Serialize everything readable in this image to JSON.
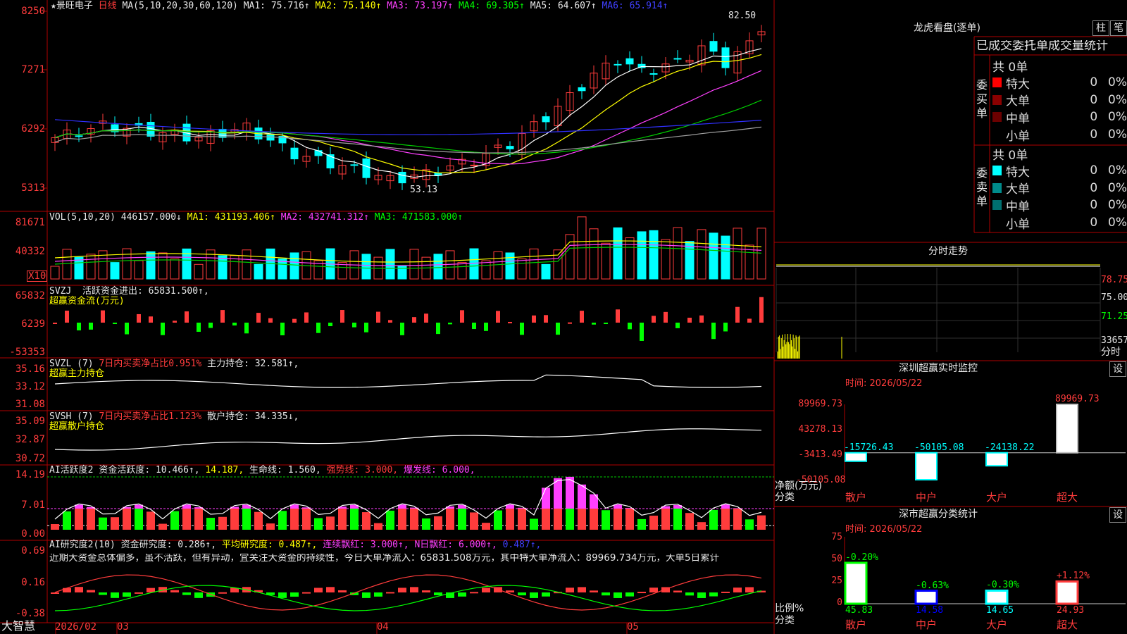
{
  "colors": {
    "up": "#ff3c3c",
    "down": "#00ffff",
    "ma1": "#ffffff",
    "ma2": "#ffff00",
    "ma3": "#ff40ff",
    "ma4": "#00cc00",
    "ma5": "#a0a0a0",
    "ma6": "#3030ff",
    "grid": "#b00000"
  },
  "price_panel": {
    "stock": "★景旺电子",
    "period": "日线",
    "ma_header": "MA(5,10,20,30,60,120)",
    "ma1": "MA1: 75.716↑",
    "ma2": "MA2: 75.140↑",
    "ma3": "MA3: 73.197↑",
    "ma4": "MA4: 69.305↑",
    "ma5": "MA5: 64.607↑",
    "ma6": "MA6: 65.914↑",
    "axis": [
      "8250",
      "7271",
      "6292",
      "5313"
    ],
    "high_label": "82.50",
    "low_label": "53.13"
  },
  "vol_panel": {
    "header": "VOL(5,10,20)",
    "v": "446157.000↓",
    "ma1": "MA1: 431193.406↑",
    "ma2": "MA2: 432741.312↑",
    "ma3": "MA3: 471583.000↑",
    "axis": [
      "81671",
      "40332"
    ],
    "unit": "X10"
  },
  "svzj_panel": {
    "name": "SVZJ",
    "desc": "活跃资金进出: 65831.500↑,",
    "sub": "超赢资金流(万元)",
    "axis": [
      "65832",
      "6239",
      "-53353"
    ]
  },
  "svzl_panel": {
    "name": "SVZL (7)",
    "desc": "7日内买卖净占比0.951%",
    "hold": "主力持仓: 32.581↑,",
    "sub": "超赢主力持仓",
    "axis": [
      "35.16",
      "33.12",
      "31.08"
    ]
  },
  "svsh_panel": {
    "name": "SVSH (7)",
    "desc": "7日内买卖净占比1.123%",
    "hold": "散户持仓: 34.335↓,",
    "sub": "超赢散户持仓",
    "axis": [
      "35.09",
      "32.87",
      "30.72"
    ]
  },
  "ai1_panel": {
    "name": "AI活跃度2",
    "a": "资金活跃度: 10.466↑,",
    "b": "14.187,",
    "c": "生命线: 1.560,",
    "d": "强势线: 3.000,",
    "e": "爆发线: 6.000,",
    "axis": [
      "14.19",
      "7.01",
      "0.00"
    ]
  },
  "ai2_panel": {
    "name": "AI研究度2(10)",
    "a": "资金研究度: 0.286↑,",
    "b": "平均研究度: 0.487↑,",
    "c": "连续飘红: 3.000↑,",
    "d": "N日飘红: 6.000↑,",
    "e": "0.487↑,",
    "comment": "近期大资金总体偏多，虽不活跃，但有异动，宜关注大资金的持续性，今日大单净流入：65831.508万元，其中特大单净流入：89969.734万元，大单5日累计",
    "axis": [
      "0.69",
      "0.16",
      "-0.38"
    ]
  },
  "bottom": {
    "brand": "大智慧",
    "dates": [
      "2026/02",
      "03",
      "04",
      "05"
    ]
  },
  "lhb": {
    "title": "龙虎看盘(逐单)",
    "btn1": "柱",
    "btn2": "笔",
    "tabs": "已成交委托单成交量统计",
    "buy_label": "委买单",
    "sell_label": "委卖单",
    "buy_total": "共 0单",
    "sell_total": "共 0单",
    "buy_rows": [
      {
        "name": "特大",
        "n": "0",
        "p": "0%",
        "color": "#ff0000"
      },
      {
        "name": "大单",
        "n": "0",
        "p": "0%",
        "color": "#8b0000"
      },
      {
        "name": "中单",
        "n": "0",
        "p": "0%",
        "color": "#6b0000"
      },
      {
        "name": "小单",
        "n": "0",
        "p": "0%",
        "color": "#000000"
      }
    ],
    "sell_rows": [
      {
        "name": "特大",
        "n": "0",
        "p": "0%",
        "color": "#00ffff"
      },
      {
        "name": "大单",
        "n": "0",
        "p": "0%",
        "color": "#008b8b"
      },
      {
        "name": "中单",
        "n": "0",
        "p": "0%",
        "color": "#007070"
      },
      {
        "name": "小单",
        "n": "0",
        "p": "0%",
        "color": "#000000"
      }
    ]
  },
  "fenshi": {
    "title": "分时走势",
    "axis": [
      "78.75",
      "75.00",
      "71.25",
      "33657"
    ],
    "unit": "分时"
  },
  "monitor": {
    "title": "深圳超赢实时监控",
    "set": "设",
    "time": "时间: 2026/05/22",
    "axis": [
      "89969.73",
      "43278.13",
      "-3413.49",
      "-50105.08"
    ],
    "ylabel": "净额(万元)",
    "xlab": "分类",
    "chart_data": {
      "type": "bar",
      "categories": [
        "散户",
        "中户",
        "大户",
        "超大"
      ],
      "values": [
        -15726.43,
        -50105.08,
        -24138.22,
        89969.73
      ],
      "labels": [
        "-15726.43",
        "-50105.08",
        "-24138.22",
        "89969.73"
      ],
      "ylim": [
        -50105.08,
        89969.73
      ]
    }
  },
  "stats": {
    "title": "深市超赢分类统计",
    "set": "设",
    "time": "时间: 2026/05/22",
    "axis": [
      "75",
      "50",
      "25",
      "0"
    ],
    "ylabel": "比例%",
    "xlab": "分类",
    "chart_data": {
      "type": "bar",
      "categories": [
        "散户",
        "中户",
        "大户",
        "超大"
      ],
      "values": [
        45.83,
        14.58,
        14.65,
        24.93
      ],
      "changes": [
        "-0.20%",
        "-0.63%",
        "-0.30%",
        "+1.12%"
      ],
      "value_labels": [
        "45.83",
        "14.58",
        "14.65",
        "24.93"
      ],
      "ylim": [
        0,
        75
      ]
    }
  }
}
